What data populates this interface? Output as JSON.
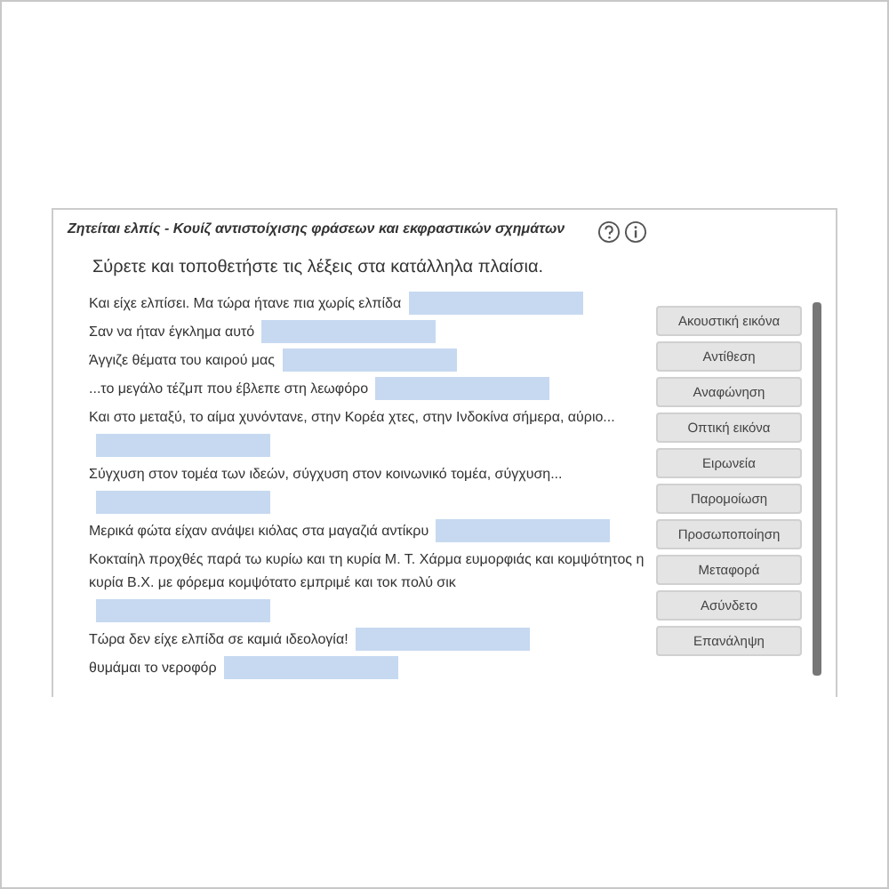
{
  "quiz": {
    "title": "Ζητείται ελπίς - Κουίζ αντιστοίχισης φράσεων και εκφραστικών σχημάτων",
    "instruction": "Σύρετε και τοποθετήστε τις λέξεις στα κατάλληλα πλαίσια.",
    "sentences": [
      {
        "text": "Και είχε ελπίσει. Μα τώρα ήτανε πια χωρίς ελπίδα"
      },
      {
        "text": "Σαν να ήταν έγκλημα αυτό"
      },
      {
        "text": "Άγγιζε θέματα του καιρού μας"
      },
      {
        "text": "...το μεγάλο τέζμπ που έβλεπε στη λεωφόρο"
      },
      {
        "text": "Και στο μεταξύ, το αίμα χυνόντανε, στην Κορέα χτες, στην Ινδοκίνα σήμερα, αύριο..."
      },
      {
        "text": "Σύγχυση στον τομέα των ιδεών, σύγχυση στον κοινωνικό τομέα, σύγχυση..."
      },
      {
        "text": "Μερικά φώτα είχαν ανάψει κιόλας στα μαγαζιά αντίκρυ"
      },
      {
        "text": "Κοκταίηλ προχθές παρά τω κυρίω και τη κυρία Μ. Τ. Χάρμα ευμορφιάς και κομψότητος η κυρία Β.Χ. με φόρεμα κομψότατο εμπριμέ και τοκ πολύ σικ"
      },
      {
        "text": "Τώρα δεν είχε ελπίδα σε καμιά ιδεολογία!"
      },
      {
        "text": "θυμάμαι το νεροφόρ"
      }
    ],
    "words": [
      "Ακουστική εικόνα",
      "Αντίθεση",
      "Αναφώνηση",
      "Οπτική εικόνα",
      "Ειρωνεία",
      "Παρομοίωση",
      "Προσωποποίηση",
      "Μεταφορά",
      "Ασύνδετο",
      "Επανάληψη"
    ]
  }
}
